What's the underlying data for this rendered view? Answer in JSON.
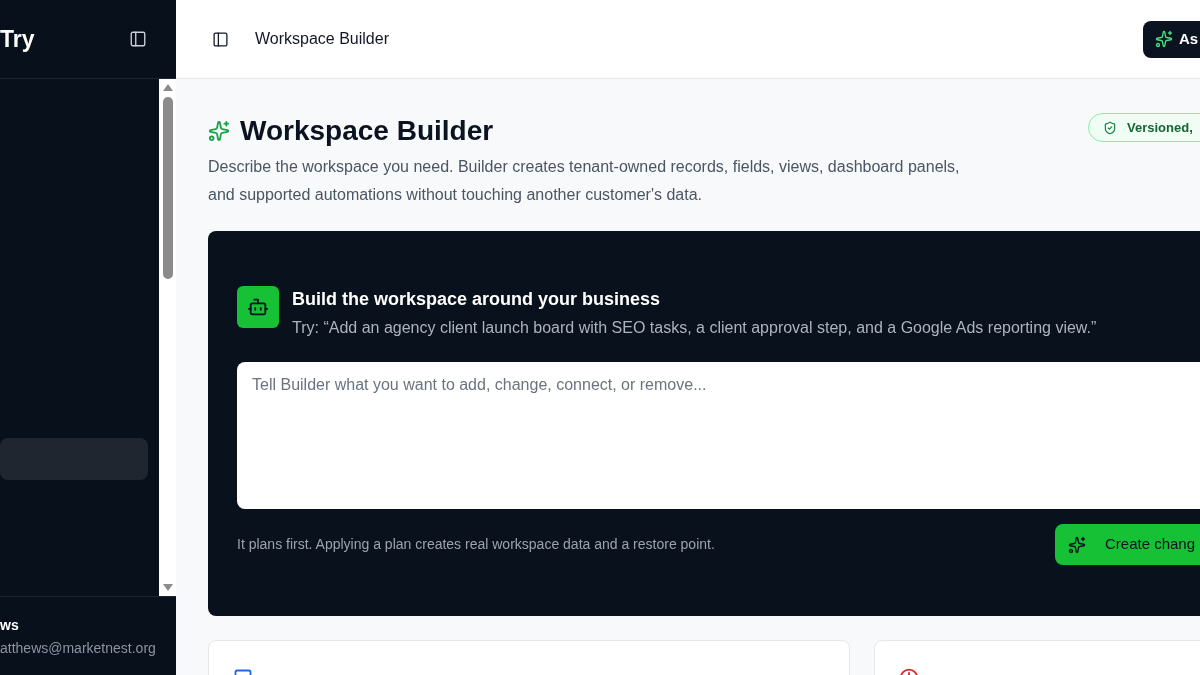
{
  "sidebar": {
    "brand": "Try",
    "nav_items": [
      {
        "selected": true
      }
    ],
    "user": {
      "name": "ws",
      "email": "atthews@marketnest.org"
    }
  },
  "header": {
    "title": "Workspace Builder",
    "ask_button": "As"
  },
  "page": {
    "title": "Workspace Builder",
    "description": "Describe the workspace you need. Builder creates tenant-owned records, fields, views, dashboard panels, and supported automations without touching another customer's data.",
    "badge": "Versioned,"
  },
  "builder": {
    "title": "Build the workspace around your business",
    "example": "Try: “Add an agency client launch board with SEO tasks, a client approval step, and a Google Ads reporting view.”",
    "input": {
      "placeholder": "Tell Builder what you want to add, change, connect, or remove..."
    },
    "hint": "It plans first. Applying a plan creates real workspace data and a restore point.",
    "submit_button": "Create chang"
  },
  "cards": [
    {
      "kind": "additions"
    },
    {
      "kind": "history"
    }
  ]
}
